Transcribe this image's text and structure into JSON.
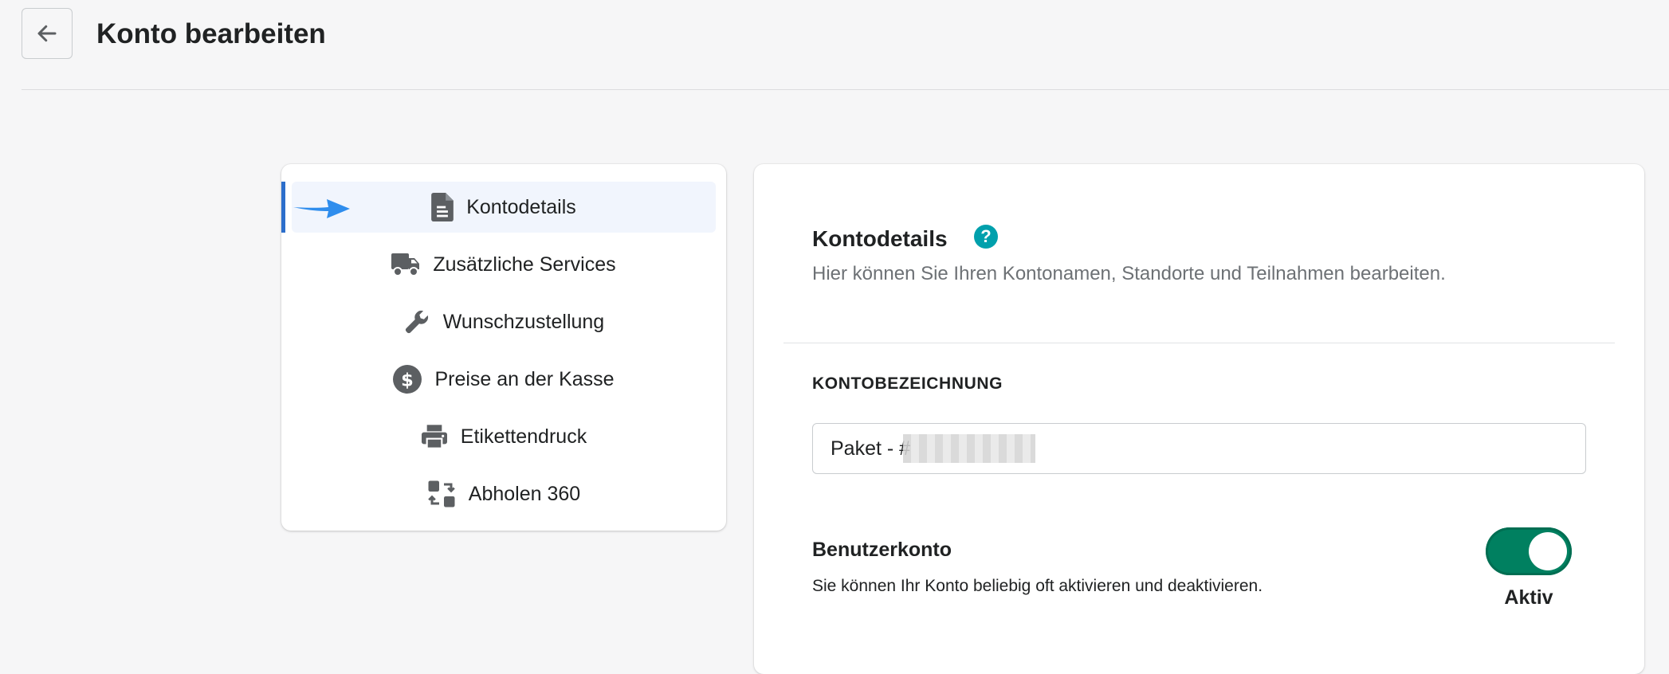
{
  "header": {
    "title": "Konto bearbeiten",
    "back_icon": "arrow-left-icon"
  },
  "nav": {
    "active_index": 0,
    "accent_color": "#2c6ecb",
    "annotation_arrow_color": "#2f8ded",
    "items": [
      {
        "label": "Kontodetails",
        "icon": "document-icon"
      },
      {
        "label": "Zusätzliche Services",
        "icon": "truck-icon"
      },
      {
        "label": "Wunschzustellung",
        "icon": "wrench-icon"
      },
      {
        "label": "Preise an der Kasse",
        "icon": "dollar-circle-icon"
      },
      {
        "label": "Etikettendruck",
        "icon": "printer-icon"
      },
      {
        "label": "Abholen 360",
        "icon": "exchange-icon"
      }
    ]
  },
  "section": {
    "title": "Kontodetails",
    "help_icon": "question-circle-icon",
    "help_glyph": "?",
    "help_color": "#00a0ac",
    "description": "Hier können Sie Ihren Kontonamen, Standorte und Teilnahmen bearbeiten."
  },
  "account_name": {
    "label": "KONTOBEZEICHNUNG",
    "value": "Paket - #"
  },
  "user_account": {
    "title": "Benutzerkonto",
    "description": "Sie können Ihr Konto beliebig oft aktivieren und deaktivieren.",
    "state_label": "Aktiv",
    "enabled": true,
    "toggle_color": "#008060"
  }
}
